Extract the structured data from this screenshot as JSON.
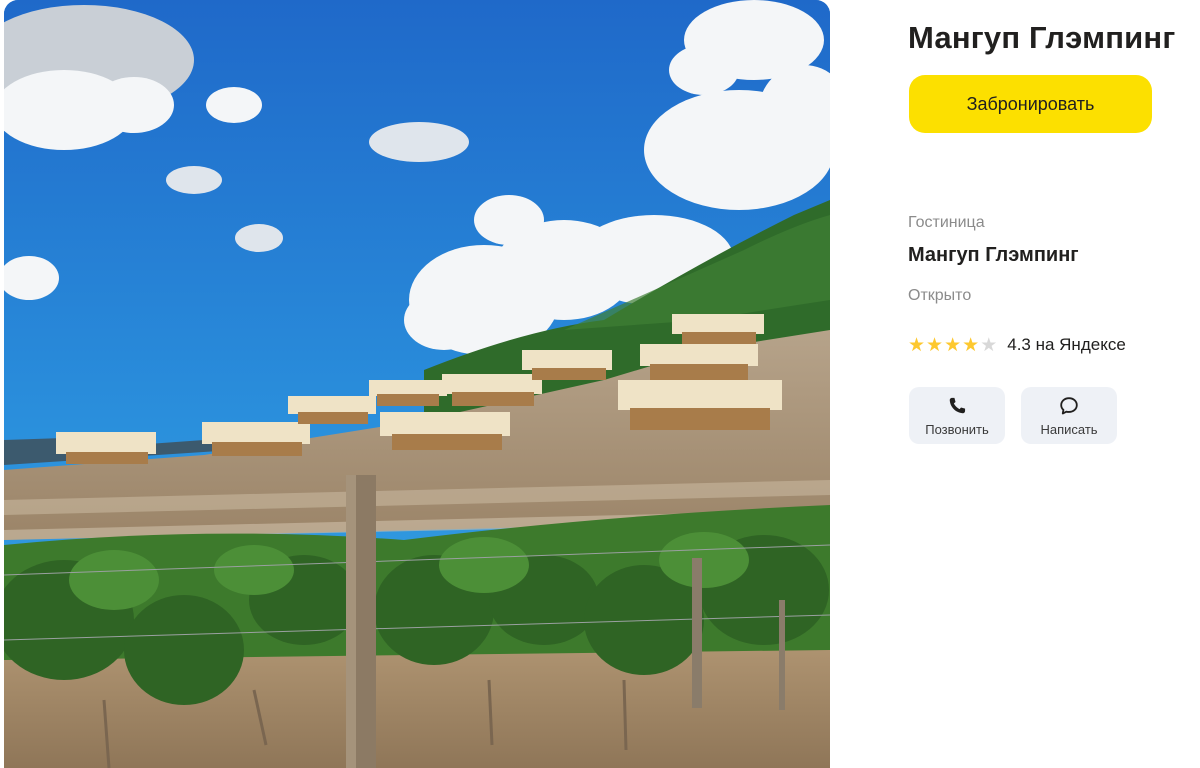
{
  "photo": {
    "icon": "campsite-photo"
  },
  "header": {
    "title": "Мангуп Глэмпинг",
    "book_label": "Забронировать"
  },
  "card": {
    "category": "Гостиница",
    "name": "Мангуп Глэмпинг",
    "status": "Открыто",
    "rating": {
      "value": 4.3,
      "stars_filled": 4,
      "stars_total": 5,
      "text": "4.3 на  Яндексе"
    }
  },
  "actions": {
    "call_label": "Позвонить",
    "call_icon": "phone-icon",
    "message_label": "Написать",
    "message_icon": "chat-icon"
  },
  "colors": {
    "accent": "#fce000",
    "star": "#fdc82f",
    "star_off": "#d8d8d8",
    "action_bg": "#eef1f6",
    "muted_text": "#8b8b8b"
  }
}
